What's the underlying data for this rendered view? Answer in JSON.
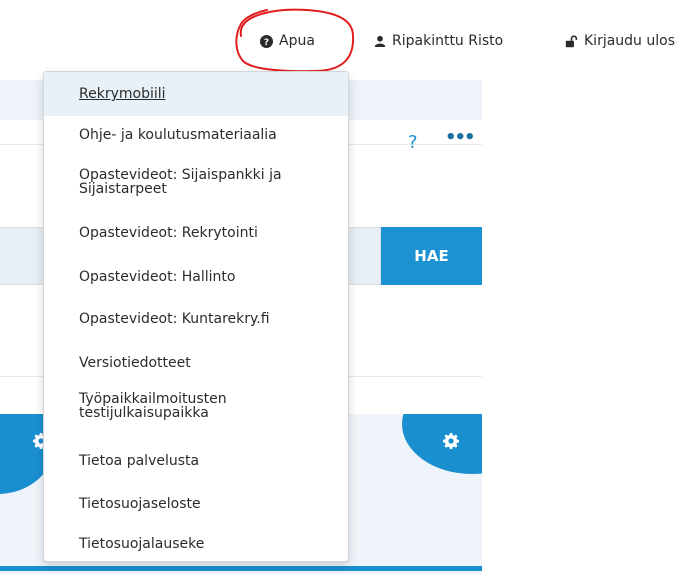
{
  "topnav": {
    "apua_label": "Apua",
    "user_label": "Ripakinttu Risto",
    "logout_label": "Kirjaudu ulos"
  },
  "toolbar": {
    "help_symbol": "?",
    "more_symbol": "•••"
  },
  "search": {
    "button_label": "HAE"
  },
  "menu": {
    "items": [
      "Rekrymobiili",
      "Ohje- ja koulutusmateriaalia",
      "Opastevideot: Sijaispankki ja Sijaistarpeet",
      "Opastevideot: Rekrytointi",
      "Opastevideot: Hallinto",
      "Opastevideot: Kuntarekry.fi",
      "Versiotiedotteet",
      "Työpaikkailmoitusten testijulkaisupaikka",
      "Tietoa palvelusta",
      "Tietosuojaseloste",
      "Tietosuojalauseke"
    ]
  },
  "colors": {
    "accent": "#1a8fd0",
    "annotation": "#e11d1d"
  },
  "icons": [
    "help-circle-icon",
    "user-icon",
    "unlock-icon",
    "gear-icon"
  ]
}
